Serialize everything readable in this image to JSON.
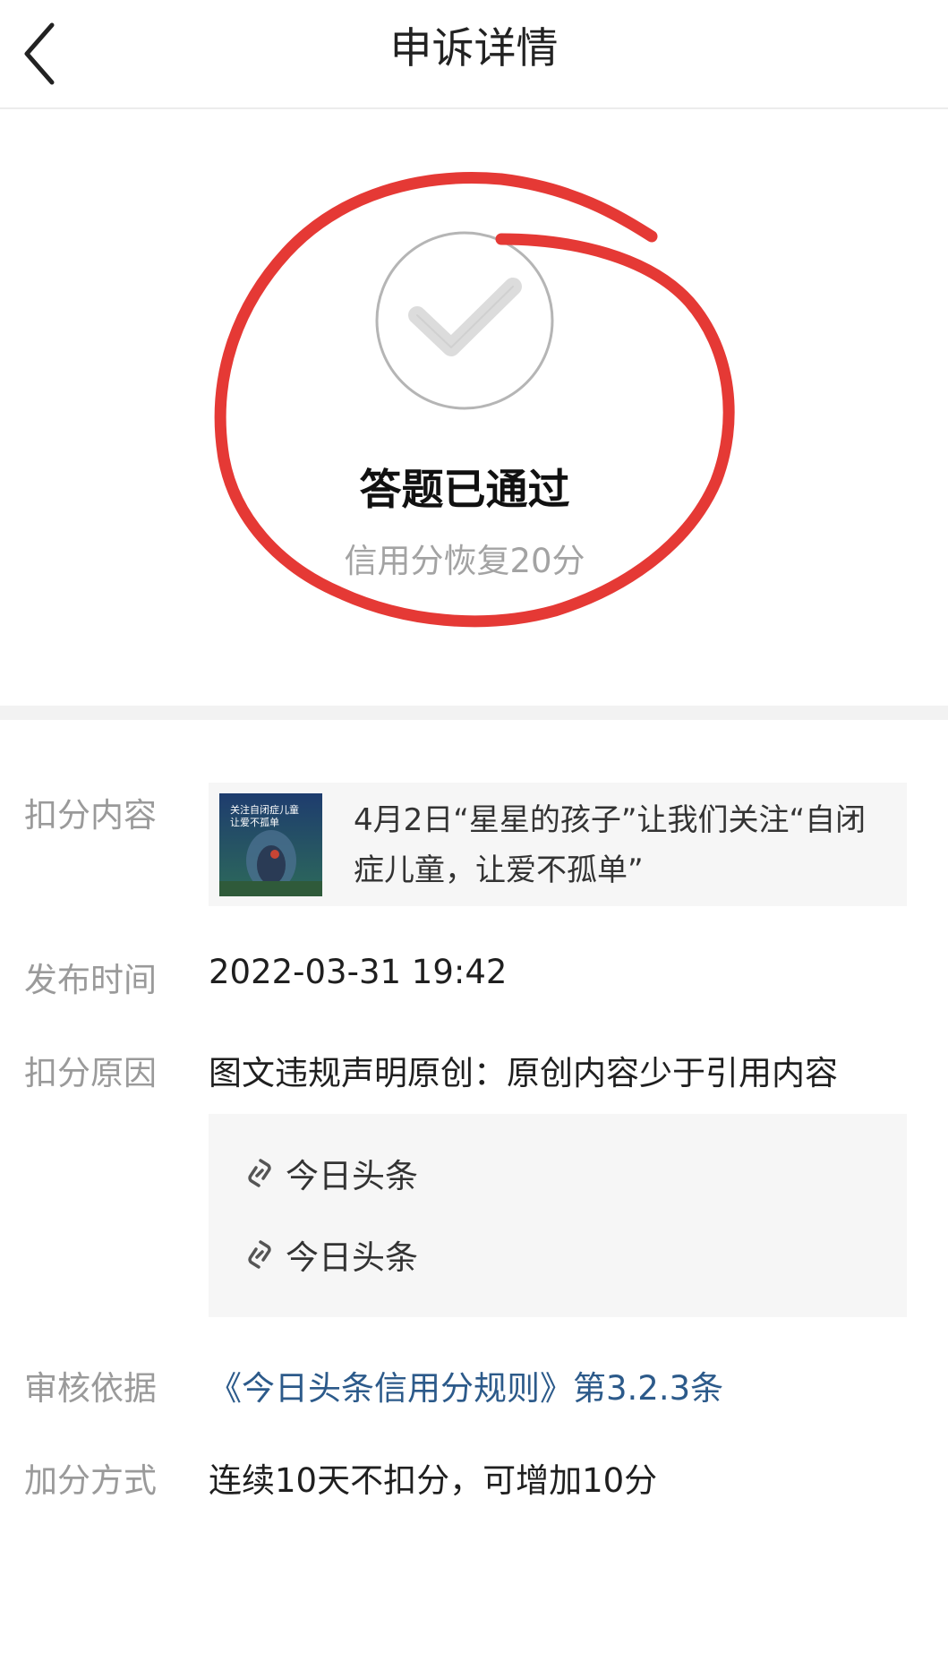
{
  "header": {
    "title": "申诉详情",
    "back_icon": "chevron-left-icon"
  },
  "status": {
    "icon": "check-circle-icon",
    "title": "答题已通过",
    "subtitle": "信用分恢复20分",
    "annotation_color": "#e53935"
  },
  "details": {
    "content": {
      "label": "扣分内容",
      "thumbnail_text_line1": "关注自闭症儿童",
      "thumbnail_text_line2": "让爱不孤单",
      "text": "4月2日“星星的孩子”让我们关注“自闭症儿童，让爱不孤单”"
    },
    "publish_time": {
      "label": "发布时间",
      "value": "2022-03-31 19:42"
    },
    "reason": {
      "label": "扣分原因",
      "value": "图文违规声明原创：原创内容少于引用内容",
      "links": [
        "今日头条",
        "今日头条"
      ],
      "link_icon": "link-icon"
    },
    "basis": {
      "label": "审核依据",
      "value": "《今日头条信用分规则》第3.2.3条",
      "color": "#2c5a8a"
    },
    "bonus": {
      "label": "加分方式",
      "value": "连续10天不扣分，可增加10分"
    }
  }
}
